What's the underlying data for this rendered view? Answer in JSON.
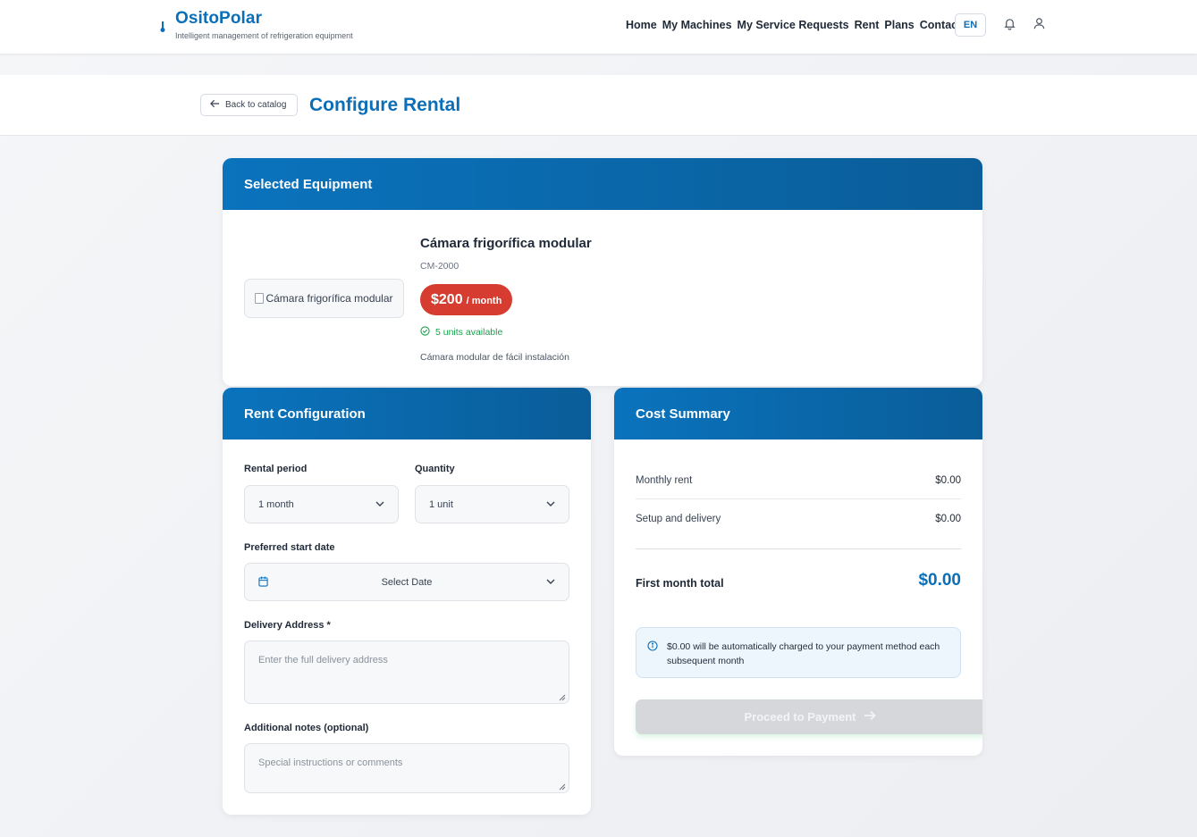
{
  "brand": {
    "name": "OsitoPolar",
    "tagline": "Intelligent management of refrigeration equipment",
    "icon": "thermometer-icon"
  },
  "nav": {
    "links": [
      "Home",
      "My Machines",
      "My Service Requests",
      "Rent",
      "Plans",
      "Contact"
    ],
    "language": "EN"
  },
  "header": {
    "back_label": "Back to catalog",
    "title": "Configure Rental"
  },
  "equipment": {
    "section_title": "Selected Equipment",
    "image_alt": "Cámara frigorífica modular",
    "name": "Cámara frigorífica modular",
    "code": "CM-2000",
    "price": "$200",
    "price_unit": "/ month",
    "availability": "5 units available",
    "description": "Cámara modular de fácil instalación"
  },
  "config": {
    "section_title": "Rent Configuration",
    "period_label": "Rental period",
    "period_value": "1 month",
    "quantity_label": "Quantity",
    "quantity_value": "1 unit",
    "start_label": "Preferred start date",
    "start_value": "Select Date",
    "address_label": "Delivery Address *",
    "address_placeholder": "Enter the full delivery address",
    "notes_label": "Additional notes (optional)",
    "notes_placeholder": "Special instructions or comments"
  },
  "summary": {
    "section_title": "Cost Summary",
    "monthly_label": "Monthly rent",
    "monthly_value": "$0.00",
    "setup_label": "Setup and delivery",
    "setup_value": "$0.00",
    "total_label": "First month total",
    "total_value": "$0.00",
    "info_text": "$0.00 will be automatically charged to your payment method each subsequent month",
    "pay_label": "Proceed to Payment"
  },
  "colors": {
    "brand": "#0b6fb8",
    "price_badge": "#d63c2f",
    "available": "#16a34a"
  }
}
